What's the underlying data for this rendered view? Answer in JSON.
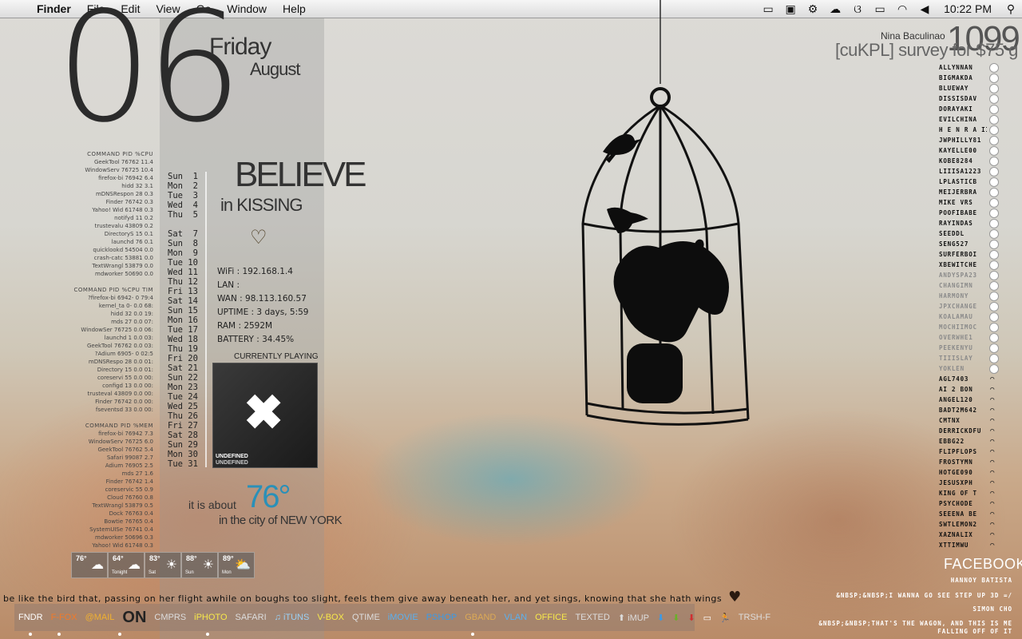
{
  "menubar": {
    "app": "Finder",
    "menus": [
      "File",
      "Edit",
      "View",
      "Go",
      "Window",
      "Help"
    ],
    "status_icons": [
      "chat-icon",
      "terminal-icon",
      "gear-icon",
      "cloud-icon",
      "butterfly-icon",
      "battery-icon",
      "wifi-icon",
      "volume-icon"
    ],
    "time": "10:22 PM"
  },
  "date": {
    "day_number": "06",
    "weekday": "Friday",
    "month": "August"
  },
  "processes": {
    "cpu": {
      "header": "COMMAND    PID %CPU",
      "rows": [
        "GeekTool  76762 11.4",
        "WindowServ 76725 10.4",
        "firefox-bi 76942 6.4",
        "hidd        32  3.1",
        "mDNSRespon  28  0.3",
        "Finder   76742  0.3",
        "Yahoo! Wid 61748 0.3",
        "notifyd    11  0.2",
        "trustevalu 43809 0.2",
        "DirectoryS  15  0.1",
        "launchd     76  0.1",
        "quicklookd 54504 0.0",
        "crash-catc 53881 0.0",
        "TextWrangl 53879 0.0",
        "mdworker  50690  0.0"
      ]
    },
    "time": {
      "header": "COMMAND   PID  %CPU TIM",
      "rows": [
        "?firefox-bi 6942- 0 79:4",
        "kernel_ta 0-  0.0 68:",
        "hidd     32  0.0 19:",
        "mds      27  0.0 07:",
        "WindowSer 76725 0.0 06:",
        "launchd   1  0.0 03:",
        "GeekTool 76762 0.0 03:",
        "?Adium  6905- 0 02:5",
        "mDNSRespo 28  0.0 01:",
        "Directory 15  0.0 01:",
        "coreservi 55  0.0 00:",
        "configd   13  0.0 00:",
        "trusteval 43809 0.0 00:",
        "Finder  76742 0.0 00:",
        "fseventsd 33  0.0 00:"
      ]
    },
    "mem": {
      "header": "COMMAND    PID %MEM",
      "rows": [
        "firefox-bi 76942 7.3",
        "WindowServ 76725 6.0",
        "GeekTool  76762 5.4",
        "Safari    99087 2.7",
        "Adium     76905 2.5",
        "mds          27 1.6",
        "Finder    76742 1.4",
        "coreservic    55 0.9",
        "Cloud     76760 0.8",
        "TextWrangl 53879 0.5",
        "Dock      76763 0.4",
        "Bowtie    76765 0.4",
        "SystemUISe 76741 0.4",
        "mdworker  50696 0.3",
        "Yahoo! Wid 61748 0.3"
      ]
    }
  },
  "calendar": [
    "Sun  1",
    "Mon  2",
    "Tue  3",
    "Wed  4",
    "Thu  5",
    "",
    "Sat  7",
    "Sun  8",
    "Mon  9",
    "Tue 10",
    "Wed 11",
    "Thu 12",
    "Fri 13",
    "Sat 14",
    "Sun 15",
    "Mon 16",
    "Tue 17",
    "Wed 18",
    "Thu 19",
    "Fri 20",
    "Sat 21",
    "Sun 22",
    "Mon 23",
    "Tue 24",
    "Wed 25",
    "Thu 26",
    "Fri 27",
    "Sat 28",
    "Sun 29",
    "Mon 30",
    "Tue 31"
  ],
  "slogan": {
    "line1": "BELIEVE",
    "line2": "in KISSING",
    "heart": "♡"
  },
  "network": {
    "wifi": "WiFi : 192.168.1.4",
    "lan": "LAN :",
    "wan": "WAN : 98.113.160.57",
    "uptime": "UPTIME : 3 days, 5:59",
    "ram": "RAM : 2592M",
    "battery": "BATTERY : 34.45%"
  },
  "now_playing": {
    "label": "CURRENTLY PLAYING",
    "title": "UNDEFINED",
    "artist": "UNDEFINED"
  },
  "weather": {
    "prefix": "it is about",
    "temp": "76°",
    "suffix": "in the city of NEW YORK",
    "forecast": [
      {
        "temp": "76°",
        "label": "",
        "icon": "moon-cloud-icon"
      },
      {
        "temp": "64°",
        "label": "Tonight",
        "icon": "moon-cloud-icon"
      },
      {
        "temp": "83°",
        "label": "Sat",
        "icon": "sun-icon"
      },
      {
        "temp": "88°",
        "label": "Sun",
        "icon": "sun-icon"
      },
      {
        "temp": "89°",
        "label": "Mon",
        "icon": "sun-cloud-icon"
      }
    ]
  },
  "top_right": {
    "name": "Nina Baculinao",
    "number": "1099",
    "survey": "[cuKPL] survey for $75 g"
  },
  "buddies": {
    "online": [
      "ALLYNNAN",
      "BIGMAKDA",
      "BLUEWAY",
      "DISSISDAV",
      "DORAYAKI",
      "EVILCHINA",
      "H E N R A II",
      "JWPHILLY81",
      "KAYELLE00",
      "KOBE8284",
      "LIIISA1223",
      "LPLASTICB",
      "MEIJERBRA",
      "MIKE VRS",
      "POOFIBABE",
      "RAYINDAS",
      "SEEDDL",
      "SENG527",
      "SURFERBOI",
      "XBEWITCHE"
    ],
    "away": [
      "ANDYSPA23",
      "CHANGIMN",
      "HARMONY",
      "JPXCHANGE",
      "KOALAMAU",
      "MOCHIIMOC",
      "OVERWHE1",
      "PEEKENYU",
      "TIIISLAY",
      "YOKLEN"
    ],
    "mobile": [
      "AGL7403",
      "AI 2 BON",
      "ANGEL120",
      "BADT2M642",
      "CMTNX",
      "DERRICKDFU",
      "EBBG22",
      "FLIPFLOPS",
      "FROSTYMN",
      "HOTGE090",
      "JESUSXPH",
      "KING OF T",
      "PSYCHODE",
      "SEEENA BE",
      "SWTLEMON2",
      "XAZNALIX",
      "XTTIMWU"
    ]
  },
  "facebook": {
    "title": "FACEBOOK",
    "items": [
      "HANNOY BATISTA",
      "&NBSP;&NBSP;I WANNA GO SEE STEP UP 3D =/",
      "SIMON CHO",
      "&NBSP;&NBSP;THAT'S THE WAGON, AND THIS IS ME",
      "FALLING OFF OF IT"
    ]
  },
  "quote": {
    "text": "be like the bird that, passing on her flight awhile on boughs too slight, feels them give away beneath her, and yet sings, knowing that she hath wings",
    "heart": "♥"
  },
  "dock": [
    {
      "label": "FNDR",
      "color": "#ffffff",
      "icon": "apple-icon"
    },
    {
      "label": "F-FOX",
      "color": "#f07a2a"
    },
    {
      "label": "@MAIL",
      "color": "#f0b030"
    },
    {
      "label": "ON",
      "color": "#222222"
    },
    {
      "label": "CMPRS",
      "color": "#dddddd"
    },
    {
      "label": "iPHOTO",
      "color": "#f7e84a"
    },
    {
      "label": "SAFARI",
      "color": "#dddddd"
    },
    {
      "label": "iTUNS",
      "color": "#9ad0f5",
      "icon": "music-note-icon"
    },
    {
      "label": "V-BOX",
      "color": "#f7e84a"
    },
    {
      "label": "QTIME",
      "color": "#dddddd"
    },
    {
      "label": "iMOVIE",
      "color": "#5ab0f0"
    },
    {
      "label": "PSHOP",
      "color": "#3a9ae8"
    },
    {
      "label": "GBAND",
      "color": "#ddaa55"
    },
    {
      "label": "VLAN",
      "color": "#5ab0f0"
    },
    {
      "label": "OFFICE",
      "color": "#f7e84a"
    },
    {
      "label": "TEXTED",
      "color": "#dddddd"
    },
    {
      "label": "iMUP",
      "color": "#dddddd",
      "icon": "arrow-up-icon"
    },
    {
      "label": "",
      "color": "#3a9ae8",
      "icon": "arrow-down-blue-icon"
    },
    {
      "label": "",
      "color": "#6ab02a",
      "icon": "arrow-down-green-icon"
    },
    {
      "label": "",
      "color": "#d03030",
      "icon": "arrow-down-red-icon"
    },
    {
      "label": "",
      "color": "#ffffff",
      "icon": "screen-icon"
    },
    {
      "label": "",
      "color": "#f0c030",
      "icon": "aim-icon"
    },
    {
      "label": "TRSH-F",
      "color": "#dddddd"
    }
  ]
}
